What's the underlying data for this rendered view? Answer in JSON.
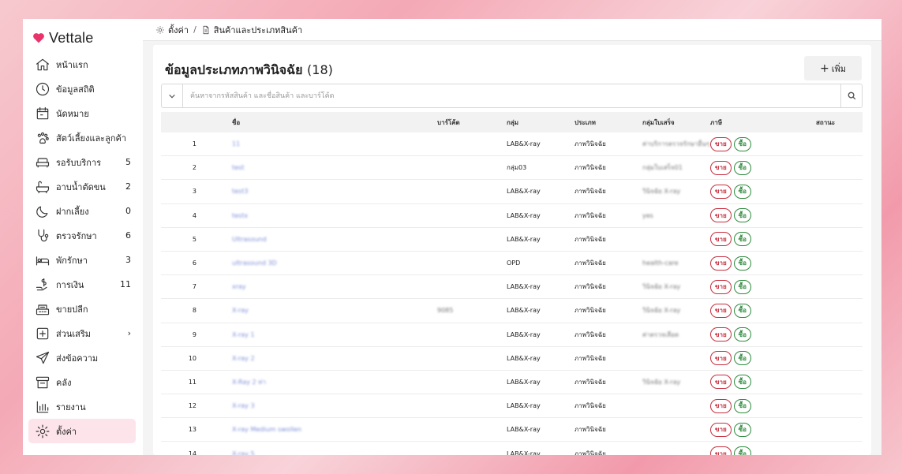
{
  "app": {
    "name": "Vettale",
    "brand_color": "#e8336b"
  },
  "sidebar": {
    "items": [
      {
        "label": "หน้าแรก",
        "icon": "home-icon",
        "badge": ""
      },
      {
        "label": "ข้อมูลสถิติ",
        "icon": "stats-icon",
        "badge": ""
      },
      {
        "label": "นัดหมาย",
        "icon": "calendar-icon",
        "badge": ""
      },
      {
        "label": "สัตว์เลี้ยงและลูกค้า",
        "icon": "paw-icon",
        "badge": ""
      },
      {
        "label": "รอรับบริการ",
        "icon": "sofa-icon",
        "badge": "5"
      },
      {
        "label": "อาบน้ำตัดขน",
        "icon": "bathtub-icon",
        "badge": "2"
      },
      {
        "label": "ฝากเลี้ยง",
        "icon": "moon-icon",
        "badge": "0"
      },
      {
        "label": "ตรวจรักษา",
        "icon": "stethoscope-icon",
        "badge": "6"
      },
      {
        "label": "พักรักษา",
        "icon": "bed-icon",
        "badge": "3"
      },
      {
        "label": "การเงิน",
        "icon": "money-icon",
        "badge": "11"
      },
      {
        "label": "ขายปลีก",
        "icon": "cash-register-icon",
        "badge": ""
      },
      {
        "label": "ส่วนเสริม",
        "icon": "plus-square-icon",
        "badge": "›"
      },
      {
        "label": "ส่งข้อความ",
        "icon": "send-icon",
        "badge": ""
      },
      {
        "label": "คลัง",
        "icon": "box-icon",
        "badge": ""
      },
      {
        "label": "รายงาน",
        "icon": "bar-chart-icon",
        "badge": ""
      },
      {
        "label": "ตั้งค่า",
        "icon": "gear-icon",
        "badge": ""
      }
    ],
    "active_index": 15
  },
  "breadcrumb": {
    "root": "ตั้งค่า",
    "separator": "/",
    "current": "สินค้าและประเภทสินค้า"
  },
  "page": {
    "title": "ข้อมูลประเภทภาพวินิจฉัย",
    "count": "(18)",
    "add_label": "เพิ่ม"
  },
  "search": {
    "placeholder": "ค้นหาจากรหัสสินค้า และชื่อสินค้า และบาร์โค้ด"
  },
  "table": {
    "headers": {
      "name": "ชื่อ",
      "barcode": "บาร์โค้ด",
      "group": "กลุ่ม",
      "type": "ประเภท",
      "bill_group": "กลุ่มใบเสร็จ",
      "tax": "ภาษี",
      "status": "สถานะ"
    },
    "sell_label": "ขาย",
    "buy_label": "ซื้อ",
    "rows": [
      {
        "no": "1",
        "name": "11",
        "barcode": "",
        "group": "LAB&X-ray",
        "type": "ภาพวินิจฉัย",
        "bill_group": "ค่าบริการตรวจรักษาอื่นๆ"
      },
      {
        "no": "2",
        "name": "test",
        "barcode": "",
        "group": "กลุ่ม03",
        "type": "ภาพวินิจฉัย",
        "bill_group": "กลุ่มใบเสร็จ01"
      },
      {
        "no": "3",
        "name": "test3",
        "barcode": "",
        "group": "LAB&X-ray",
        "type": "ภาพวินิจฉัย",
        "bill_group": "วินิจฉัย X-ray"
      },
      {
        "no": "4",
        "name": "testx",
        "barcode": "",
        "group": "LAB&X-ray",
        "type": "ภาพวินิจฉัย",
        "bill_group": "yes"
      },
      {
        "no": "5",
        "name": "Ultrasound",
        "barcode": "",
        "group": "LAB&X-ray",
        "type": "ภาพวินิจฉัย",
        "bill_group": ""
      },
      {
        "no": "6",
        "name": "ultrasound 3D",
        "barcode": "",
        "group": "OPD",
        "type": "ภาพวินิจฉัย",
        "bill_group": "health-care"
      },
      {
        "no": "7",
        "name": "xray",
        "barcode": "",
        "group": "LAB&X-ray",
        "type": "ภาพวินิจฉัย",
        "bill_group": "วินิจฉัย X-ray"
      },
      {
        "no": "8",
        "name": "X-ray",
        "barcode": "9085",
        "group": "LAB&X-ray",
        "type": "ภาพวินิจฉัย",
        "bill_group": "วินิจฉัย X-ray"
      },
      {
        "no": "9",
        "name": "X-ray 1",
        "barcode": "",
        "group": "LAB&X-ray",
        "type": "ภาพวินิจฉัย",
        "bill_group": "ค่าตรวจเลือด"
      },
      {
        "no": "10",
        "name": "X-ray 2",
        "barcode": "",
        "group": "LAB&X-ray",
        "type": "ภาพวินิจฉัย",
        "bill_group": ""
      },
      {
        "no": "11",
        "name": "X-Ray 2 ท่า",
        "barcode": "",
        "group": "LAB&X-ray",
        "type": "ภาพวินิจฉัย",
        "bill_group": "วินิจฉัย X-ray"
      },
      {
        "no": "12",
        "name": "X-ray 3",
        "barcode": "",
        "group": "LAB&X-ray",
        "type": "ภาพวินิจฉัย",
        "bill_group": ""
      },
      {
        "no": "13",
        "name": "X-ray Medium swollen",
        "barcode": "",
        "group": "LAB&X-ray",
        "type": "ภาพวินิจฉัย",
        "bill_group": ""
      },
      {
        "no": "14",
        "name": "X-ray 5",
        "barcode": "",
        "group": "LAB&X-ray",
        "type": "ภาพวินิจฉัย",
        "bill_group": ""
      }
    ]
  }
}
